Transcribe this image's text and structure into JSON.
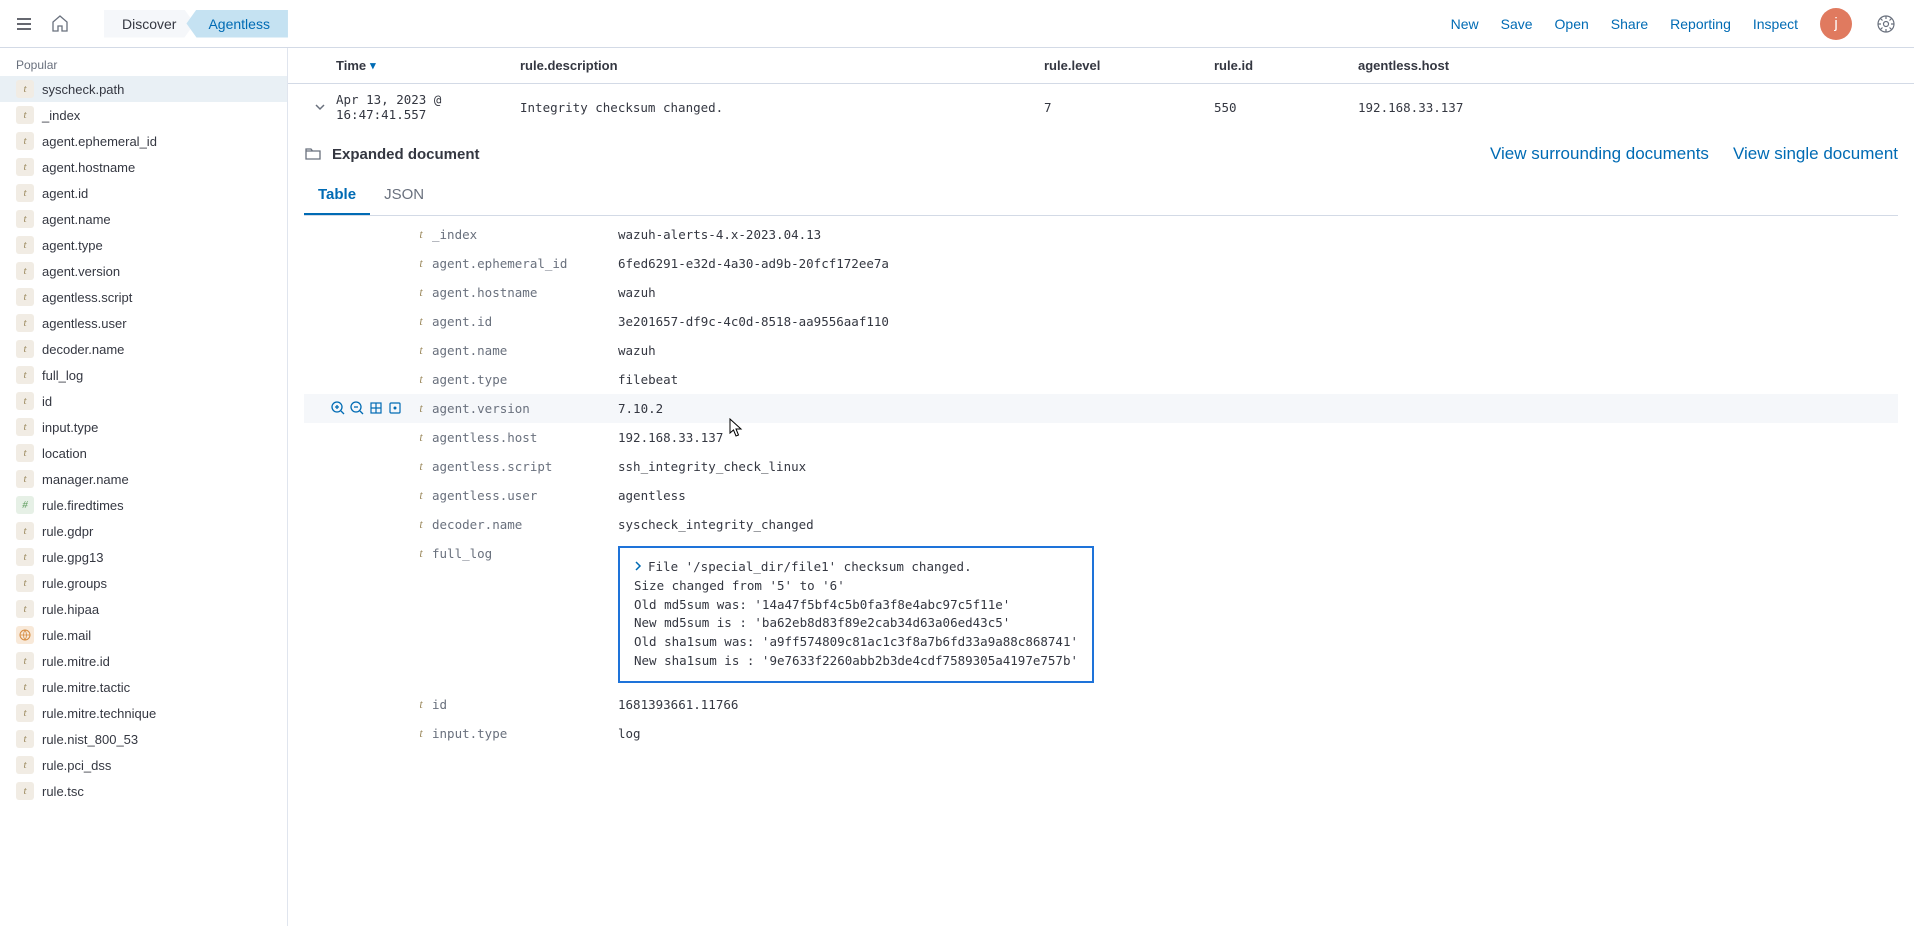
{
  "nav": {
    "breadcrumb1": "Discover",
    "breadcrumb2": "Agentless",
    "actions": [
      "New",
      "Save",
      "Open",
      "Share",
      "Reporting",
      "Inspect"
    ],
    "avatar_initial": "j"
  },
  "sidebar": {
    "label": "Popular",
    "fields": [
      {
        "type": "t",
        "name": "syscheck.path",
        "selected": true
      },
      {
        "type": "t",
        "name": "_index"
      },
      {
        "type": "t",
        "name": "agent.ephemeral_id"
      },
      {
        "type": "t",
        "name": "agent.hostname"
      },
      {
        "type": "t",
        "name": "agent.id"
      },
      {
        "type": "t",
        "name": "agent.name"
      },
      {
        "type": "t",
        "name": "agent.type"
      },
      {
        "type": "t",
        "name": "agent.version"
      },
      {
        "type": "t",
        "name": "agentless.script"
      },
      {
        "type": "t",
        "name": "agentless.user"
      },
      {
        "type": "t",
        "name": "decoder.name"
      },
      {
        "type": "t",
        "name": "full_log"
      },
      {
        "type": "t",
        "name": "id"
      },
      {
        "type": "t",
        "name": "input.type"
      },
      {
        "type": "t",
        "name": "location"
      },
      {
        "type": "t",
        "name": "manager.name"
      },
      {
        "type": "hash",
        "name": "rule.firedtimes"
      },
      {
        "type": "t",
        "name": "rule.gdpr"
      },
      {
        "type": "t",
        "name": "rule.gpg13"
      },
      {
        "type": "t",
        "name": "rule.groups"
      },
      {
        "type": "t",
        "name": "rule.hipaa"
      },
      {
        "type": "geo",
        "name": "rule.mail"
      },
      {
        "type": "t",
        "name": "rule.mitre.id"
      },
      {
        "type": "t",
        "name": "rule.mitre.tactic"
      },
      {
        "type": "t",
        "name": "rule.mitre.technique"
      },
      {
        "type": "t",
        "name": "rule.nist_800_53"
      },
      {
        "type": "t",
        "name": "rule.pci_dss"
      },
      {
        "type": "t",
        "name": "rule.tsc"
      }
    ]
  },
  "header": {
    "time": "Time",
    "desc": "rule.description",
    "level": "rule.level",
    "id": "rule.id",
    "host": "agentless.host"
  },
  "row": {
    "time": "Apr 13, 2023 @ 16:47:41.557",
    "desc": "Integrity checksum changed.",
    "level": "7",
    "id": "550",
    "host": "192.168.33.137"
  },
  "expanded": {
    "title": "Expanded document",
    "link1": "View surrounding documents",
    "link2": "View single document",
    "tab1": "Table",
    "tab2": "JSON"
  },
  "doc": [
    {
      "k": "_index",
      "v": "wazuh-alerts-4.x-2023.04.13"
    },
    {
      "k": "agent.ephemeral_id",
      "v": "6fed6291-e32d-4a30-ad9b-20fcf172ee7a"
    },
    {
      "k": "agent.hostname",
      "v": "wazuh"
    },
    {
      "k": "agent.id",
      "v": "3e201657-df9c-4c0d-8518-aa9556aaf110"
    },
    {
      "k": "agent.name",
      "v": "wazuh"
    },
    {
      "k": "agent.type",
      "v": "filebeat"
    },
    {
      "k": "agent.version",
      "v": "7.10.2",
      "hovered": true
    },
    {
      "k": "agentless.host",
      "v": "192.168.33.137"
    },
    {
      "k": "agentless.script",
      "v": "ssh_integrity_check_linux"
    },
    {
      "k": "agentless.user",
      "v": "agentless"
    },
    {
      "k": "decoder.name",
      "v": "syscheck_integrity_changed"
    },
    {
      "k": "full_log",
      "v": "",
      "full_log": true
    },
    {
      "k": "id",
      "v": "1681393661.11766"
    },
    {
      "k": "input.type",
      "v": "log"
    }
  ],
  "full_log_lines": [
    "File '/special_dir/file1' checksum changed.",
    "Size changed from '5' to '6'",
    "Old md5sum was: '14a47f5bf4c5b0fa3f8e4abc97c5f11e'",
    "New md5sum is : 'ba62eb8d83f89e2cab34d63a06ed43c5'",
    "Old sha1sum was: 'a9ff574809c81ac1c3f8a7b6fd33a9a88c868741'",
    "New sha1sum is : '9e7633f2260abb2b3de4cdf7589305a4197e757b'"
  ]
}
